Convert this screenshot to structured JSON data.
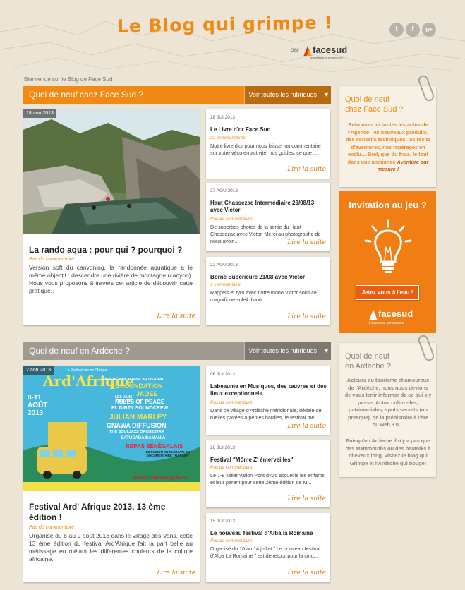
{
  "header": {
    "title": "Le Blog qui grimpe !",
    "par": "par",
    "brand": "facesud",
    "brand_tag": "L'aventure sur mesure",
    "social": [
      "t",
      "f",
      "g+"
    ]
  },
  "welcome": "Bienvenue sur le Blog de Face Sud",
  "sections": [
    {
      "title": "Quoi de neuf chez Face Sud ?",
      "button": "Voir toutes les rubriques",
      "caret": "▾",
      "featured": {
        "date": "18 aou 2013",
        "title": "La rando aqua : pour qui ? pourquoi ?",
        "meta": "Pas de commentaire",
        "excerpt": "Version soft du canyoning, la randonnée aquatique a le même objectif : descendre une rivière de montagne (canyon). Nous vous proposons à travers cet article de découvrir cette pratique..",
        "more": "Lire la suite"
      },
      "posts": [
        {
          "date": "28 JUI 2013",
          "title": "Le Livre d'or Face Sud",
          "meta": "22 commentaires",
          "excerpt": "Notre livre d'or pour nous laisser un commentaire sur votre vécu en activité, nos guides, ce que ...",
          "more": "Lire la suite"
        },
        {
          "date": "27 AOU 2013",
          "title": "Haut Chassezac Intermédiaire 23/08/13 avec Victor",
          "meta": "Pas de commentaire",
          "excerpt": "De superbes photos de la sortie du Haut Chassezac avec Victor. Merci au photographe de nous avoir...",
          "more": "Lire la suite"
        },
        {
          "date": "22 AOU 2013",
          "title": "Borne Supérieure 21/08 avec Victor",
          "meta": "1 commentaire",
          "excerpt": "Rappels et tyro avec notre mono Victor sous ce magnifique soleil d'août",
          "more": "Lire la suite"
        }
      ]
    },
    {
      "title": "Quoi de neuf en Ardèche ?",
      "button": "Voir toutes les rubriques",
      "caret": "▾",
      "featured": {
        "date": "2 aou 2013",
        "title": "Festival Ard' Afrique 2013, 13 ème édition !",
        "meta": "Pas de commentaire",
        "excerpt": "Organisé du 8 au 9 aout 2013 dans le village des Vans, cette 13 ème édition du festival Ard'Afrique fait la part belle au métissage en mêlant les differentes couleurs de la culture africaine.",
        "more": "Lire la suite"
      },
      "posts": [
        {
          "date": "06 JUI 2013",
          "title": "Labeaume en Musiques, des œuvres et des lieux exceptionnels…",
          "meta": "Pas de commentaire",
          "excerpt": "Dans ce village d'Ardèche méridionale, dédale de ruelles pavées à pentes hardies, le festival mê...",
          "more": "Lire la suite"
        },
        {
          "date": "28 JUI 2013",
          "title": "Festival \"Môme Z' émerveilles\"",
          "meta": "Pas de commentaire",
          "excerpt": "Le 7-8 juillet Vallon Pont d'Arc accueille les enfants et leur parent pour cette 2ème édition de M...",
          "more": "Lire la suite"
        },
        {
          "date": "15 JUI 2013",
          "title": "Le nouveau festival d'Alba la Romaine",
          "meta": "Pas de commentaire",
          "excerpt": "Organisé du 10 au 14 juillet \" Le nouveau festival d'Alba La Romaine \" est de retour pour la cinq...",
          "more": "Lire la suite"
        }
      ]
    }
  ],
  "poster": {
    "top": "La Petite école de l'Afrique",
    "title": "Ard'Afrique",
    "dates": "8-11 AOÛT 2013",
    "town": "LES VANS ARDÈCHE",
    "market": "MARCHÉ NOCTURNE ARTISANAL",
    "acts": [
      "GROUNDATION",
      "JAQEE",
      "RULES OF PEACE",
      "EL DIRTY SOUNDCREW",
      "JULIAN MARLEY",
      "GNAWA DIFFUSION",
      "THE SOULJAZZ ORCHESTRA",
      "BATUCADA BAMANIA"
    ],
    "meals": "REPAS SÉNÉGALAIS",
    "doc": "DIFFUSION EN PLEIN AIR DU DOCUMENTAIRE \"MARLEY\"",
    "web": "WWW.ARDAFRIQUE.FR"
  },
  "sidebar": {
    "note1": {
      "title_l1": "Quoi de neuf",
      "title_l2": "chez Face Sud ?",
      "text": "Retrouvez ici toutes les actus de l'Agence: les nouveaux produits, des conseils techniques, les récits d'aventures, nos repérages en exclu… Bref, que du frais, le tout dans une ambiance ",
      "text_em": "Aventure sur mesure !"
    },
    "promo": {
      "title": "Invitation au jeu ?",
      "button": "Jetez vous à l'eau !",
      "brand": "facesud",
      "tag": "L'aventure sur mesure"
    },
    "note2": {
      "title_l1": "Quoi de neuf",
      "title_l2": "en Ardèche ?",
      "text1": "Acteurs du tourisme et amoureux de l'Ardèche, nous nous devions de vous tenir informer de ce qui s'y passe: Actus culturelles, patrimoniales, spots secrets (ou presque), de la préhistoire à l'ère du web 3.0…",
      "text2": "Puisqu'en Ardèche il n'y a pas que des Mammouths ou des beatniks à cheveux long, visitez le blog qui Grimpe et l'Ardèche qui bouge!"
    }
  },
  "colors": {
    "orange": "#f08a14",
    "gray_bar": "#a09a90",
    "bg": "#ece5d6"
  }
}
